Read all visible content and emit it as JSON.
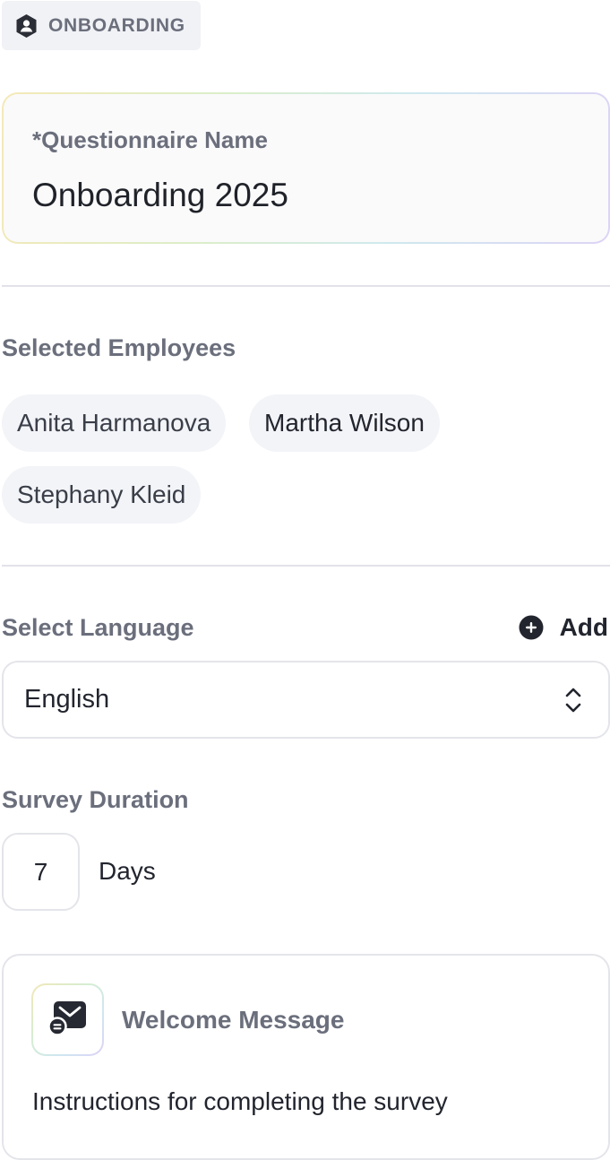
{
  "header": {
    "badge_label": "ONBOARDING",
    "badge_icon": "user-shield-icon"
  },
  "questionnaire": {
    "label": "*Questionnaire Name",
    "value": "Onboarding 2025"
  },
  "employees": {
    "label": "Selected Employees",
    "items": [
      "Anita Harmanova",
      "Martha Wilson",
      "Stephany Kleid"
    ]
  },
  "language": {
    "label": "Select Language",
    "add_label": "Add",
    "add_icon": "plus-circle-icon",
    "selected": "English",
    "chevron_icon": "chevron-up-down-icon"
  },
  "duration": {
    "label": "Survey Duration",
    "value": "7",
    "unit": "Days"
  },
  "welcome": {
    "title": "Welcome Message",
    "icon": "envelope-message-icon",
    "body": "Instructions for completing the survey"
  },
  "colors": {
    "label_gray": "#6b6f7c",
    "text_dark": "#22252e",
    "chip_bg": "#f3f4f8",
    "border": "#e4e5ea",
    "divider": "#e3e2ea"
  }
}
